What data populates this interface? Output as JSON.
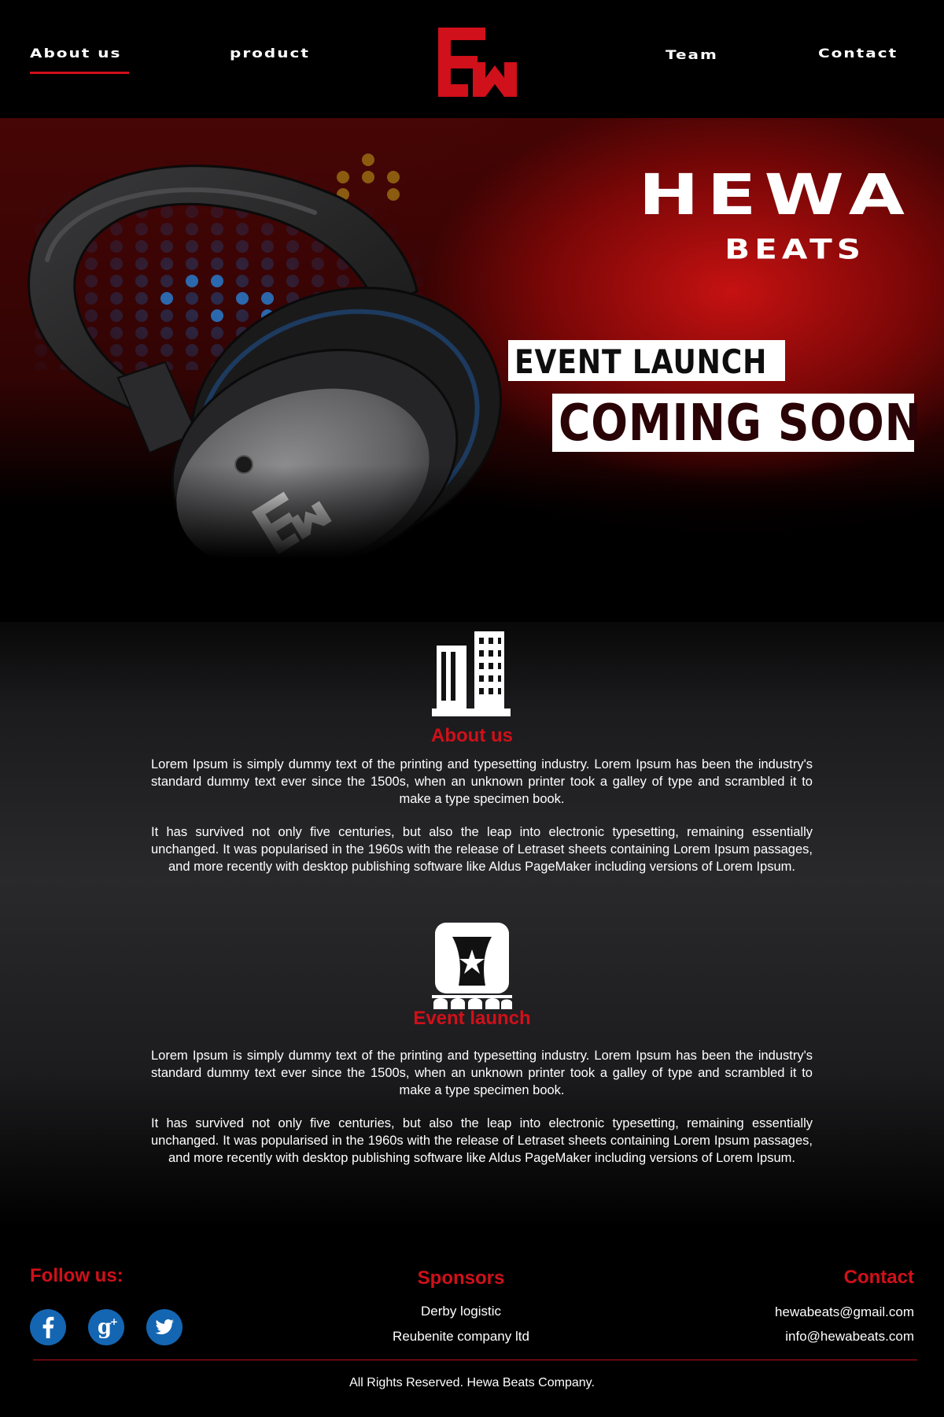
{
  "nav": {
    "about": "About us",
    "product": "product",
    "team": "Team",
    "contact": "Contact"
  },
  "hero": {
    "title": "HEWA",
    "subtitle": "BEATS",
    "event_launch": "EVENT LAUNCH",
    "coming_soon": "COMING SOON"
  },
  "about": {
    "title": "About us",
    "p1": "Lorem Ipsum is simply dummy text of the printing and typesetting industry. Lorem Ipsum has been the industry's standard dummy text ever since the 1500s, when an unknown printer took a galley of type and scrambled it to make a type specimen book.",
    "p2": "It has survived not only five centuries, but also the leap into electronic typesetting, remaining essentially unchanged. It was popularised in the 1960s with the release of Letraset sheets containing Lorem Ipsum passages, and more recently with desktop publishing software like Aldus PageMaker including versions of Lorem Ipsum."
  },
  "event": {
    "title": "Event launch",
    "p1": "Lorem Ipsum is simply dummy text of the printing and typesetting industry. Lorem Ipsum has been the industry's standard dummy text ever since the 1500s, when an unknown printer took a galley of type and scrambled it to make a type specimen book.",
    "p2": "It has survived not only five centuries, but also the leap into electronic typesetting, remaining essentially unchanged. It was popularised in the 1960s with the release of Letraset sheets containing Lorem Ipsum passages, and more recently with desktop publishing software like Aldus PageMaker including versions of Lorem Ipsum."
  },
  "footer": {
    "follow_title": "Follow us:",
    "social_icons": [
      "facebook-icon",
      "google-plus-icon",
      "twitter-icon"
    ],
    "sponsors_title": "Sponsors",
    "sponsors": [
      "Derby logistic",
      "Reubenite company ltd"
    ],
    "contact_title": "Contact",
    "emails": [
      "hewabeats@gmail.com",
      "info@hewabeats.com"
    ],
    "copyright": "All Rights Reserved. Hewa Beats Company."
  },
  "colors": {
    "accent": "#d0101a",
    "social_blue": "#1466b2",
    "background": "#000000"
  }
}
